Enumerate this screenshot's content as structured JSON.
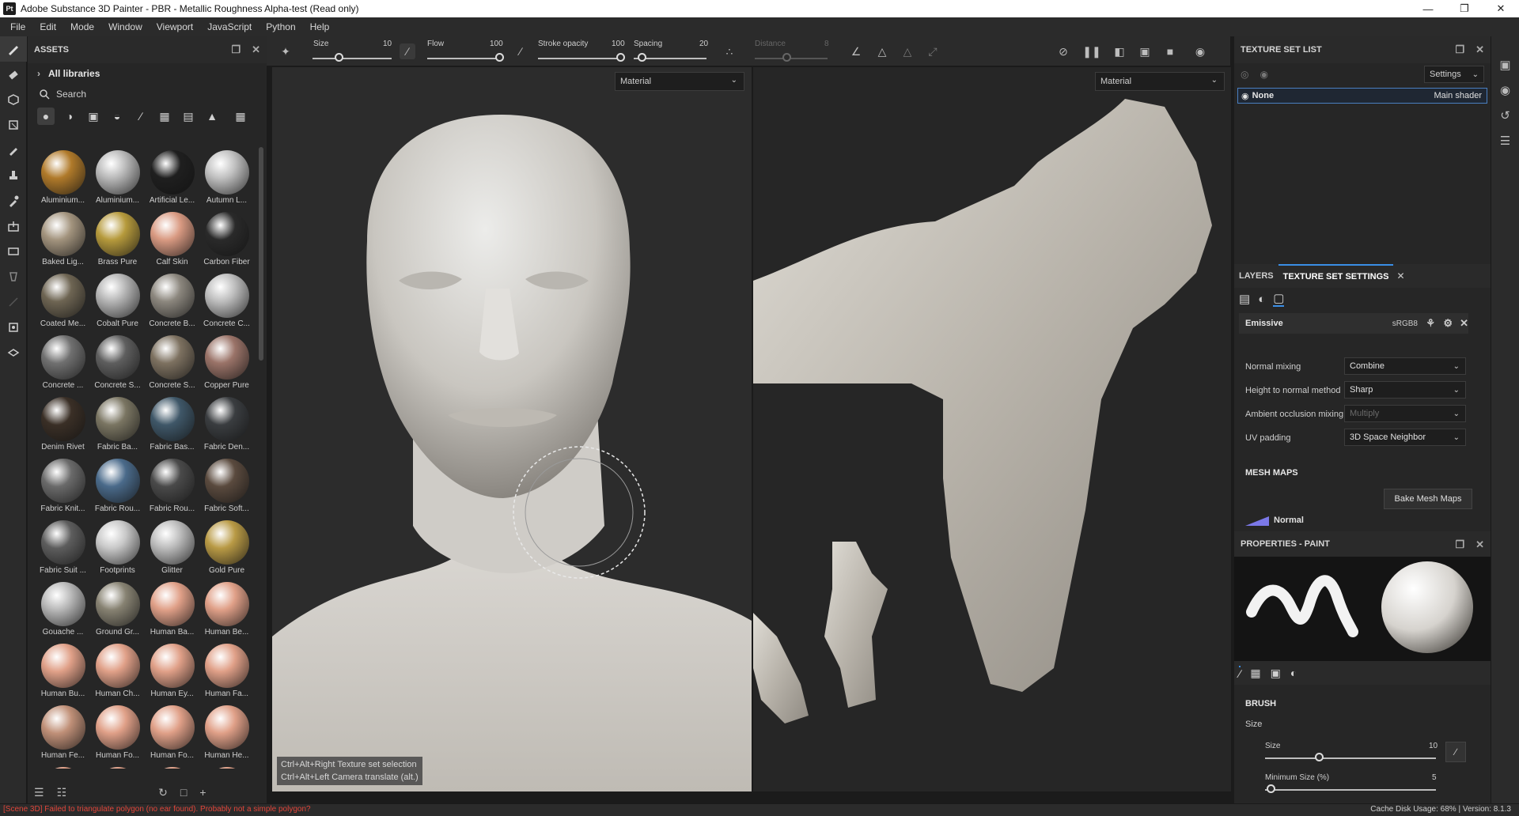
{
  "window": {
    "title": "Adobe Substance 3D Painter - PBR - Metallic Roughness Alpha-test (Read only)",
    "logo": "Pt"
  },
  "menu": [
    "File",
    "Edit",
    "Mode",
    "Window",
    "Viewport",
    "JavaScript",
    "Python",
    "Help"
  ],
  "assets": {
    "title": "ASSETS",
    "library": "All libraries",
    "search_placeholder": "Search",
    "items": [
      {
        "label": "Aluminium...",
        "color": "#b07a2a"
      },
      {
        "label": "Aluminium...",
        "color": "#b9b9b9"
      },
      {
        "label": "Artificial Le...",
        "color": "#1f1f1f"
      },
      {
        "label": "Autumn L...",
        "color": "#c0c0c0"
      },
      {
        "label": "Baked Lig...",
        "color": "#a3947e"
      },
      {
        "label": "Brass Pure",
        "color": "#b69a3c"
      },
      {
        "label": "Calf Skin",
        "color": "#d99a82"
      },
      {
        "label": "Carbon Fiber",
        "color": "#2a2a2a"
      },
      {
        "label": "Coated Me...",
        "color": "#6e6553"
      },
      {
        "label": "Cobalt Pure",
        "color": "#b4b4b4"
      },
      {
        "label": "Concrete B...",
        "color": "#8c877e"
      },
      {
        "label": "Concrete C...",
        "color": "#bdbdbd"
      },
      {
        "label": "Concrete ...",
        "color": "#707070"
      },
      {
        "label": "Concrete S...",
        "color": "#5e5e5e"
      },
      {
        "label": "Concrete S...",
        "color": "#7d7160"
      },
      {
        "label": "Copper Pure",
        "color": "#9a7368"
      },
      {
        "label": "Denim Rivet",
        "color": "#3a2f26"
      },
      {
        "label": "Fabric Ba...",
        "color": "#7a7562"
      },
      {
        "label": "Fabric Bas...",
        "color": "#3f5768"
      },
      {
        "label": "Fabric Den...",
        "color": "#3a3d40"
      },
      {
        "label": "Fabric Knit...",
        "color": "#6a6a6a"
      },
      {
        "label": "Fabric Rou...",
        "color": "#4a6a8a"
      },
      {
        "label": "Fabric Rou...",
        "color": "#4a4a4a"
      },
      {
        "label": "Fabric Soft...",
        "color": "#5a4a3e"
      },
      {
        "label": "Fabric Suit ...",
        "color": "#5d5d5d"
      },
      {
        "label": "Footprints",
        "color": "#c8c8c8"
      },
      {
        "label": "Glitter",
        "color": "#bcbcbc"
      },
      {
        "label": "Gold Pure",
        "color": "#b99a45"
      },
      {
        "label": "Gouache ...",
        "color": "#b8b8b8"
      },
      {
        "label": "Ground Gr...",
        "color": "#878272"
      },
      {
        "label": "Human Ba...",
        "color": "#e0a088"
      },
      {
        "label": "Human Be...",
        "color": "#e0a088"
      },
      {
        "label": "Human Bu...",
        "color": "#e0a088"
      },
      {
        "label": "Human Ch...",
        "color": "#e0a088"
      },
      {
        "label": "Human Ey...",
        "color": "#e0a088"
      },
      {
        "label": "Human Fa...",
        "color": "#e0a088"
      },
      {
        "label": "Human Fe...",
        "color": "#c09078"
      },
      {
        "label": "Human Fo...",
        "color": "#e0a088"
      },
      {
        "label": "Human Fo...",
        "color": "#e0a088"
      },
      {
        "label": "Human He...",
        "color": "#e0a088"
      },
      {
        "label": "",
        "color": "#e0a088"
      },
      {
        "label": "",
        "color": "#e0a088"
      },
      {
        "label": "",
        "color": "#e0a088"
      },
      {
        "label": "",
        "color": "#e0a088"
      }
    ]
  },
  "toolbar": {
    "size": {
      "label": "Size",
      "value": "10"
    },
    "flow": {
      "label": "Flow",
      "value": "100"
    },
    "stroke_opacity": {
      "label": "Stroke opacity",
      "value": "100"
    },
    "spacing": {
      "label": "Spacing",
      "value": "20"
    },
    "distance": {
      "label": "Distance",
      "value": "8"
    }
  },
  "viewport3d": {
    "mode": "Material",
    "shortcut1": "Ctrl+Alt+Right  Texture set selection",
    "shortcut2": "Ctrl+Alt+Left   Camera translate (alt.)"
  },
  "viewport2d": {
    "mode": "Material"
  },
  "texture_set_list": {
    "title": "TEXTURE SET LIST",
    "settings": "Settings",
    "row_name": "None",
    "row_shader": "Main shader"
  },
  "tabs": {
    "layers": "LAYERS",
    "tss": "TEXTURE SET SETTINGS"
  },
  "tss": {
    "channel": "Emissive",
    "format": "sRGB8",
    "normal_mixing": {
      "label": "Normal mixing",
      "value": "Combine"
    },
    "height_to_normal": {
      "label": "Height to normal method",
      "value": "Sharp"
    },
    "ao_mixing": {
      "label": "Ambient occlusion mixing",
      "value": "Multiply"
    },
    "uv_padding": {
      "label": "UV padding",
      "value": "3D Space Neighbor"
    },
    "mesh_maps": "MESH MAPS",
    "bake_button": "Bake Mesh Maps",
    "normal": "Normal"
  },
  "properties": {
    "title": "PROPERTIES - PAINT",
    "brush": "BRUSH",
    "size_group": "Size",
    "size": {
      "label": "Size",
      "value": "10"
    },
    "min_size": {
      "label": "Minimum Size (%)",
      "value": "5"
    }
  },
  "status": {
    "error": "[Scene 3D] Failed to triangulate polygon (no ear found). Probably not a simple polygon?",
    "right": "Cache Disk Usage:   68% | Version: 8.1.3"
  }
}
